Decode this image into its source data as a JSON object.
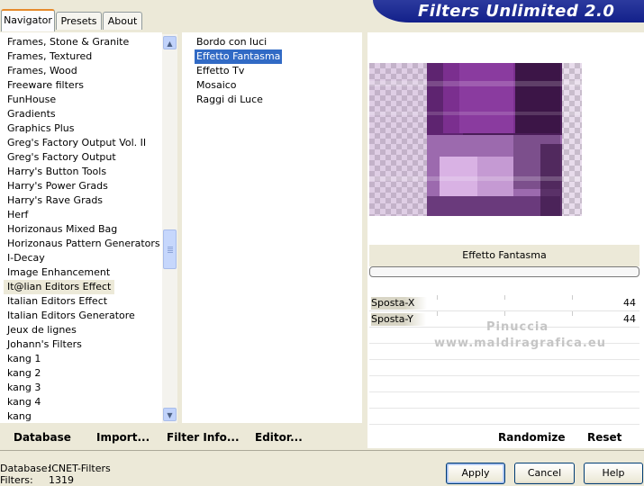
{
  "window": {
    "banner_title": "Filters Unlimited 2.0"
  },
  "tabs": [
    {
      "label": "Navigator",
      "active": true
    },
    {
      "label": "Presets",
      "active": false
    },
    {
      "label": "About",
      "active": false
    }
  ],
  "categories": {
    "items": [
      "Frames, Stone & Granite",
      "Frames, Textured",
      "Frames, Wood",
      "Freeware filters",
      "FunHouse",
      "Gradients",
      "Graphics Plus",
      "Greg's Factory Output Vol. II",
      "Greg's Factory Output",
      "Harry's Button Tools",
      "Harry's Power Grads",
      "Harry's Rave Grads",
      "Herf",
      "Horizonaus Mixed Bag",
      "Horizonaus Pattern Generators",
      "I-Decay",
      "Image Enhancement",
      "It@lian Editors Effect",
      "Italian Editors Effect",
      "Italian Editors Generatore",
      "Jeux de lignes",
      "Johann's Filters",
      "kang 1",
      "kang 2",
      "kang 3",
      "kang 4",
      "kang"
    ],
    "selected": "It@lian Editors Effect",
    "scroll_up_icon": "chevron-up-icon",
    "scroll_down_icon": "chevron-down-icon"
  },
  "filters": {
    "items": [
      "Bordo con luci",
      "Effetto Fantasma",
      "Effetto Tv",
      "Mosaico",
      "Raggi di Luce"
    ],
    "selected": "Effetto Fantasma"
  },
  "effect": {
    "name": "Effetto Fantasma",
    "params": [
      {
        "label": "Sposta-X",
        "value": "44"
      },
      {
        "label": "Sposta-Y",
        "value": "44"
      }
    ],
    "watermark_line1": "Pinuccia",
    "watermark_line2": "www.maldiragrafica.eu"
  },
  "toolbar": {
    "database": "Database",
    "import": "Import...",
    "filter_info": "Filter Info...",
    "editor": "Editor...",
    "randomize": "Randomize",
    "reset": "Reset"
  },
  "status": {
    "database_label": "Database:",
    "database_value": "ICNET-Filters",
    "filters_label": "Filters:",
    "filters_value": "1319"
  },
  "buttons": {
    "apply": "Apply",
    "cancel": "Cancel",
    "help": "Help"
  },
  "colors": {
    "banner": "#13208a",
    "selection": "#316ac5",
    "tab_highlight": "#e68b2c",
    "preview_purple": "#6a2a7a"
  }
}
